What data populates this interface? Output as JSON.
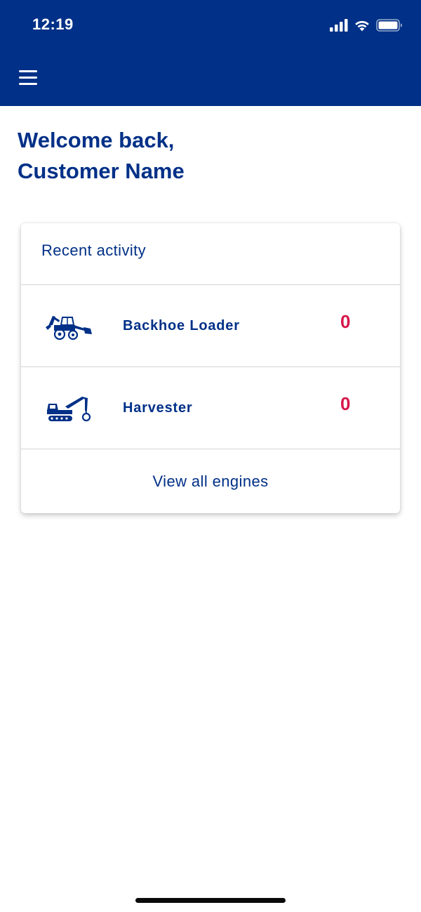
{
  "status_bar": {
    "time": "12:19",
    "icons": [
      "cellular-signal-icon",
      "wifi-icon",
      "battery-icon"
    ]
  },
  "header": {
    "background_color": "#003087",
    "menu_icon": "hamburger-menu-icon"
  },
  "welcome": {
    "line1": "Welcome back,",
    "line2": "Customer Name"
  },
  "recent_activity": {
    "title": "Recent activity",
    "engines": [
      {
        "name": "Backhoe Loader",
        "count": "0",
        "icon": "backhoe-loader-icon"
      },
      {
        "name": "Harvester",
        "count": "0",
        "icon": "harvester-icon"
      }
    ],
    "view_all_label": "View all engines"
  },
  "colors": {
    "brand_blue": "#003087",
    "count_red": "#d6174b",
    "divider": "#d3d3d3"
  }
}
